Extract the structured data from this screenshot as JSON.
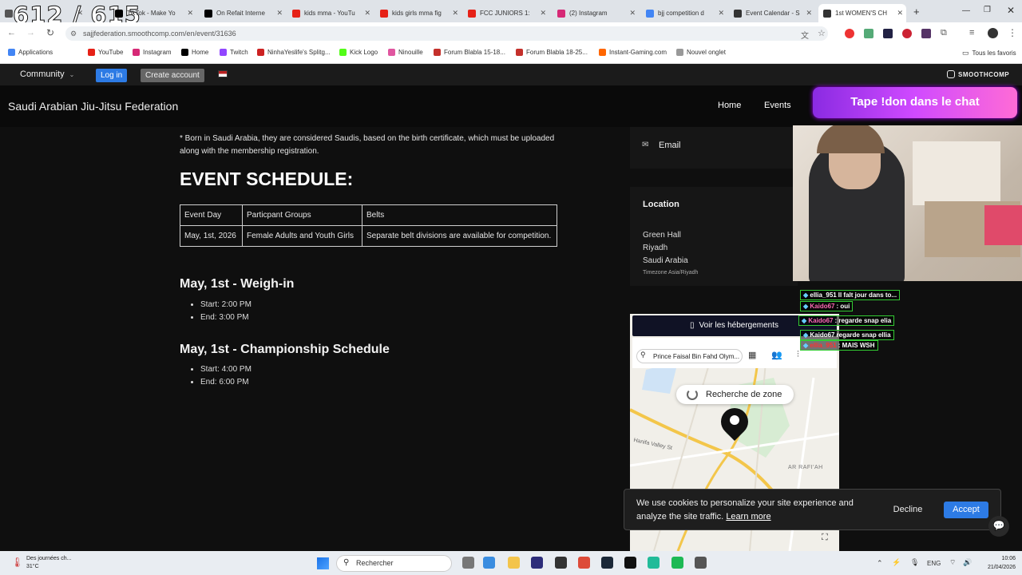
{
  "counter": "612 / 615",
  "tabs": [
    {
      "label": "",
      "color": "#555",
      "active": false
    },
    {
      "label": "TikTok - Make Yo",
      "color": "#000",
      "active": false
    },
    {
      "label": "On Refait Interne",
      "color": "#000",
      "active": false
    },
    {
      "label": "kids mma - YouTu",
      "color": "#e62117",
      "active": false
    },
    {
      "label": "kids girls mma fig",
      "color": "#e62117",
      "active": false
    },
    {
      "label": "FCC JUNIORS 1:",
      "color": "#e62117",
      "active": false
    },
    {
      "label": "(2) Instagram",
      "color": "#d62976",
      "active": false
    },
    {
      "label": "bjj competition d",
      "color": "#4285f4",
      "active": false
    },
    {
      "label": "Event Calendar - S",
      "color": "#333",
      "active": false
    },
    {
      "label": "1st WOMEN'S CH",
      "color": "#333",
      "active": true
    }
  ],
  "url": "sajjfederation.smoothcomp.com/en/event/31636",
  "bookmarks": [
    {
      "label": "Applications",
      "color": "#4285f4"
    },
    {
      "label": "YouTube",
      "color": "#e62117"
    },
    {
      "label": "Instagram",
      "color": "#d62976"
    },
    {
      "label": "Home",
      "color": "#000"
    },
    {
      "label": "Twitch",
      "color": "#9146ff"
    },
    {
      "label": "NinhaYeslife's Splitg...",
      "color": "#c22"
    },
    {
      "label": "Kick Logo",
      "color": "#53fc18"
    },
    {
      "label": "Ninouille",
      "color": "#e056a0"
    },
    {
      "label": "Forum Blabla 15-18...",
      "color": "#c4302b"
    },
    {
      "label": "Forum Blabla 18-25...",
      "color": "#c4302b"
    },
    {
      "label": "Instant-Gaming.com",
      "color": "#f60"
    },
    {
      "label": "Nouvel onglet",
      "color": "#999"
    }
  ],
  "bookmarks_right": "Tous les favoris",
  "nav": {
    "community": "Community",
    "login": "Log in",
    "create": "Create account",
    "brand": "SMOOTHCOMP"
  },
  "org": {
    "title": "Saudi Arabian Jiu-Jitsu Federation",
    "home": "Home",
    "events": "Events"
  },
  "donation_banner": "Tape !don dans le chat",
  "intro": "* Born in Saudi Arabia, they are considered Saudis, based on the birth certificate, which must be uploaded along with the membership registration.",
  "schedule_title": "EVENT SCHEDULE:",
  "table": {
    "headers": [
      "Event Day",
      "Particpant Groups",
      "Belts"
    ],
    "row": [
      "May, 1st, 2026",
      "Female Adults and Youth Girls",
      "Separate belt divisions are available for competition."
    ]
  },
  "weighin": {
    "title": "May, 1st - Weigh-in",
    "items": [
      "Start: 2:00 PM",
      "End: 3:00 PM"
    ]
  },
  "championship": {
    "title": "May, 1st - Championship Schedule",
    "items": [
      "Start: 4:00 PM",
      "End: 6:00 PM"
    ]
  },
  "sidebar": {
    "email": "Email",
    "location_title": "Location",
    "location_lines": [
      "Green Hall",
      "Riyadh",
      "Saudi Arabia"
    ],
    "timezone": "Timezone  Asia/Riyadh"
  },
  "map": {
    "top_button": "Voir les hébergements",
    "search": "Prince Faisal Bin Fahd Olym...",
    "loading": "Recherche de zone",
    "label_valley": "Hanifa Valley St",
    "label_area": "AR RAFI'AH"
  },
  "chat": [
    {
      "user": "ellia_951",
      "msg": "Il falt jour dans to...",
      "ucolor": "#ffffff"
    },
    {
      "user": "Kaido67",
      "msg": ": oui",
      "ucolor": "#ff6bb5"
    },
    {
      "user": "Kaido67",
      "msg": ": regarde snap elia",
      "ucolor": "#ff6bb5"
    },
    {
      "user": "Kaido67",
      "msg": "regarde snap ellia",
      "ucolor": "#ffffff"
    },
    {
      "user": "ellia_951",
      "msg": ": MAIS WSH",
      "ucolor": "#ff3030"
    }
  ],
  "cookie": {
    "text": "We use cookies to personalize your site experience and analyze the site traffic.",
    "link": "Learn more",
    "decline": "Decline",
    "accept": "Accept"
  },
  "taskbar": {
    "weather_title": "Des journées ch...",
    "weather_temp": "31°C",
    "search": "Rechercher",
    "lang": "ENG",
    "time": "10:06",
    "date": "21/04/2026"
  }
}
